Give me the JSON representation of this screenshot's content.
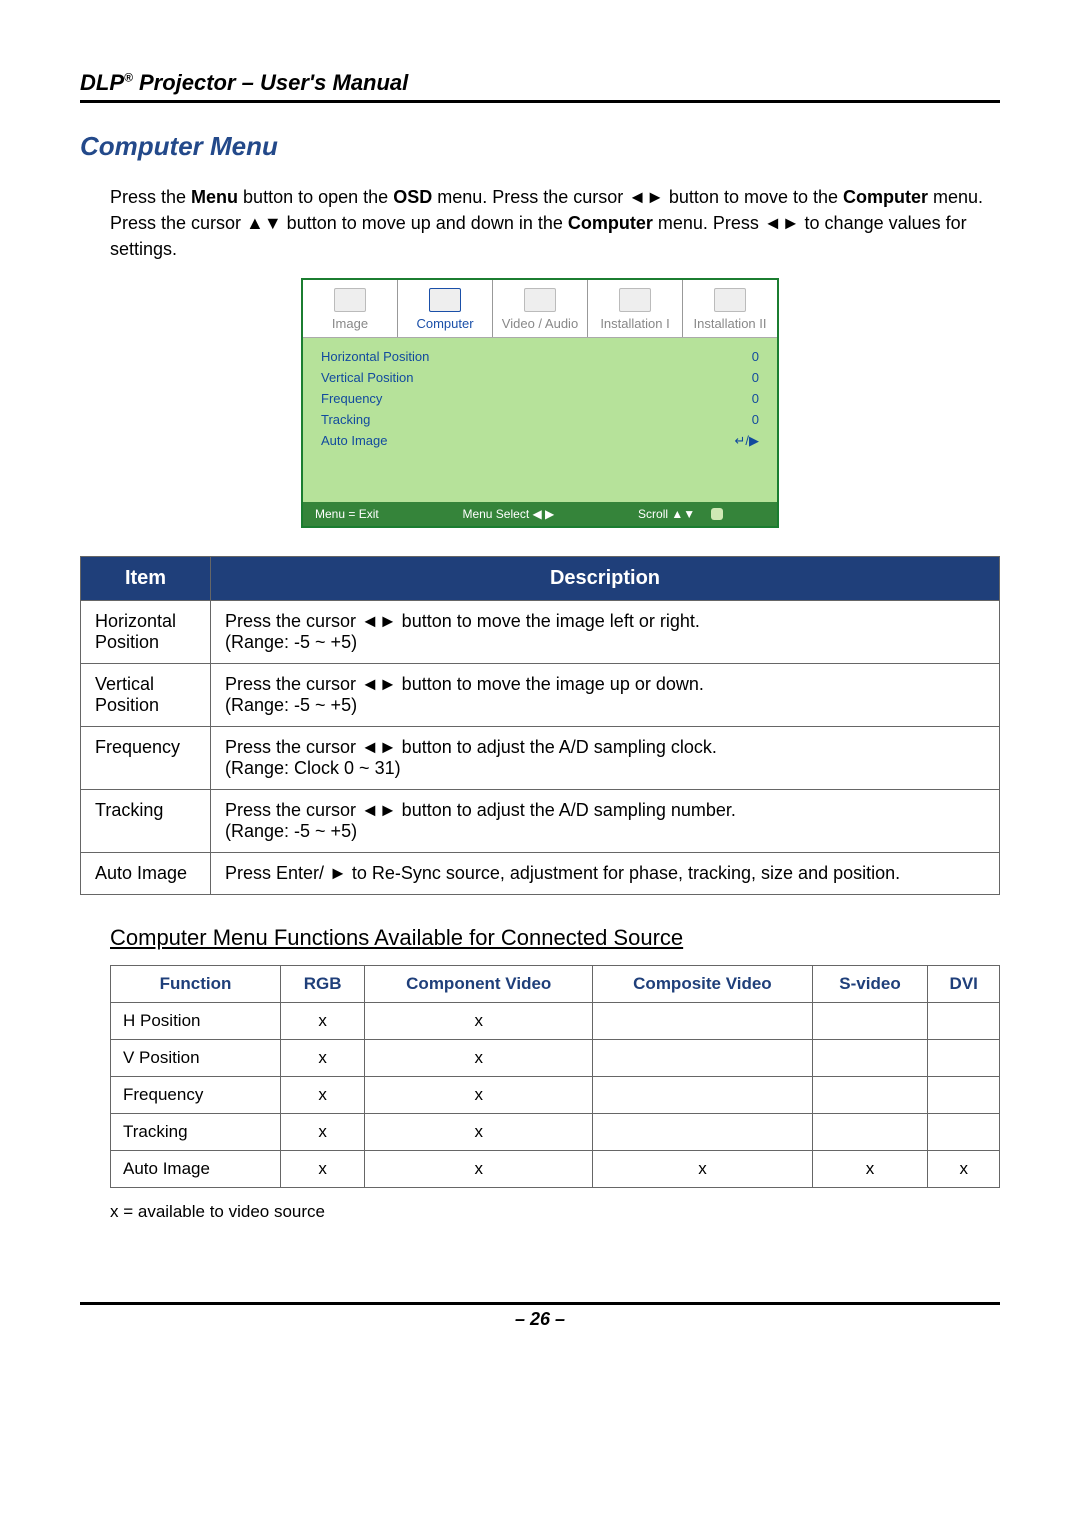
{
  "header": {
    "title_pre": "DLP",
    "title_post": " Projector – User's Manual",
    "sup": "®"
  },
  "section": {
    "title": "Computer Menu"
  },
  "intro": {
    "pre": "Press the ",
    "b1": "Menu",
    "t1": " button to open the ",
    "b2": "OSD",
    "t2": " menu. Press the cursor ◄► button to move to the ",
    "b3": "Computer",
    "t3": " menu. Press the cursor ▲▼ button to move up and down in the ",
    "b4": "Computer",
    "t4": " menu. Press ◄► to change values for settings."
  },
  "osd": {
    "tabs": [
      "Image",
      "Computer",
      "Video / Audio",
      "Installation I",
      "Installation II"
    ],
    "active_index": 1,
    "rows": [
      {
        "label": "Horizontal Position",
        "val": "0"
      },
      {
        "label": "Vertical Position",
        "val": "0"
      },
      {
        "label": "Frequency",
        "val": "0"
      },
      {
        "label": "Tracking",
        "val": "0"
      },
      {
        "label": "Auto Image",
        "val": "↵/▶"
      }
    ],
    "footer": {
      "left": "Menu = Exit",
      "mid": "Menu Select ◀ ▶",
      "right": "Scroll ▲▼"
    }
  },
  "desc": {
    "headers": [
      "Item",
      "Description"
    ],
    "rows": [
      {
        "item": "Horizontal Position",
        "desc": "Press the cursor ◄► button to move the image left or right.\n(Range: -5 ~ +5)"
      },
      {
        "item": "Vertical Position",
        "desc": "Press the cursor ◄► button to move the image up or down.\n(Range: -5 ~ +5)"
      },
      {
        "item": "Frequency",
        "desc": "Press the cursor ◄► button to adjust the A/D sampling clock.\n(Range: Clock 0 ~ 31)"
      },
      {
        "item": "Tracking",
        "desc": "Press the cursor ◄► button to adjust the A/D sampling number.\n(Range: -5 ~ +5)"
      },
      {
        "item": "Auto Image",
        "desc": "Press Enter/ ► to Re-Sync source, adjustment for phase, tracking, size and position."
      }
    ]
  },
  "subhead": "Computer Menu Functions Available for Connected Source",
  "avail": {
    "headers": [
      "Function",
      "RGB",
      "Component Video",
      "Composite Video",
      "S-video",
      "DVI"
    ],
    "rows": [
      {
        "fn": "H Position",
        "c": [
          "x",
          "x",
          "",
          "",
          ""
        ]
      },
      {
        "fn": "V Position",
        "c": [
          "x",
          "x",
          "",
          "",
          ""
        ]
      },
      {
        "fn": "Frequency",
        "c": [
          "x",
          "x",
          "",
          "",
          ""
        ]
      },
      {
        "fn": "Tracking",
        "c": [
          "x",
          "x",
          "",
          "",
          ""
        ]
      },
      {
        "fn": "Auto Image",
        "c": [
          "x",
          "x",
          "x",
          "x",
          "x"
        ]
      }
    ]
  },
  "note": "x = available to video source",
  "pagenum": "– 26 –"
}
